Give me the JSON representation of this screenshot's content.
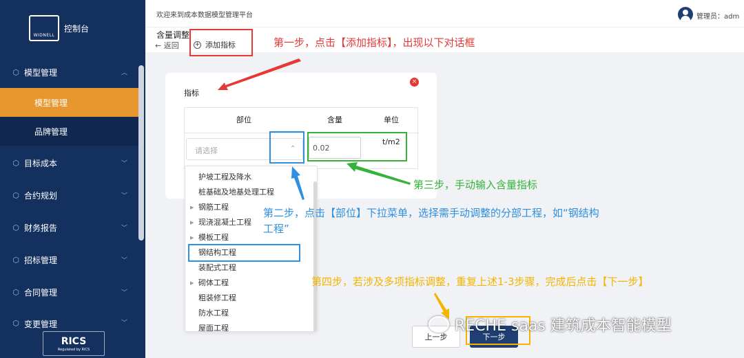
{
  "sidebar": {
    "logo_text": "WIDNELL",
    "console_label": "控制台",
    "menus": [
      {
        "label": "模型管理",
        "expanded": true
      },
      {
        "label": "目标成本"
      },
      {
        "label": "合约规划"
      },
      {
        "label": "财务报告"
      },
      {
        "label": "招标管理"
      },
      {
        "label": "合同管理"
      },
      {
        "label": "变更管理"
      }
    ],
    "submenus": [
      {
        "label": "模型管理",
        "active": true
      },
      {
        "label": "品牌管理"
      }
    ],
    "rics": {
      "main": "RICS",
      "sub": "Regulated by RICS"
    }
  },
  "header": {
    "welcome": "欢迎来到成本数据模型管理平台",
    "admin_label": "管理员：adm"
  },
  "toolbar": {
    "title": "含量调整",
    "back": "← 返回",
    "add_indicator": "添加指标"
  },
  "dialog": {
    "title": "指标",
    "close": "×",
    "columns": [
      "部位",
      "含量",
      "单位"
    ],
    "part_placeholder": "请选择",
    "caret": "⌃",
    "qty_value": "0.02",
    "unit": "t/m2"
  },
  "dropdown": {
    "items": [
      {
        "label": "护坡工程及降水",
        "has_children": false
      },
      {
        "label": "桩基础及地基处理工程",
        "has_children": false
      },
      {
        "label": "钢筋工程",
        "has_children": true
      },
      {
        "label": "现浇混凝土工程",
        "has_children": true
      },
      {
        "label": "模板工程",
        "has_children": true
      },
      {
        "label": "钢结构工程",
        "has_children": false
      },
      {
        "label": "装配式工程",
        "has_children": false
      },
      {
        "label": "砌体工程",
        "has_children": true
      },
      {
        "label": "粗装修工程",
        "has_children": false
      },
      {
        "label": "防水工程",
        "has_children": false
      },
      {
        "label": "屋面工程",
        "has_children": false
      }
    ]
  },
  "buttons": {
    "prev": "上一步",
    "next": "下一步"
  },
  "annotations": {
    "step1": "第一步，点击【添加指标】，出现以下对话框",
    "step2_line1": "第二步，点击【部位】下拉菜单，选择需手动调整的分部工程，如“钢结构",
    "step2_line2": "工程”",
    "step3": "第三步，手动输入含量指标",
    "step4": "第四步，若涉及多项指标调整，重复上述1-3步骤，完成后点击【下一步】"
  },
  "watermark": "RECHE saas 建筑成本智能模型",
  "colors": {
    "sidebar_bg": "#14305e",
    "active_menu": "#e8962e",
    "primary_button": "#1f3f72",
    "annotation_red": "#e53935",
    "annotation_blue": "#2f8fe0",
    "annotation_green": "#33b33a",
    "annotation_yellow": "#f4b400"
  }
}
